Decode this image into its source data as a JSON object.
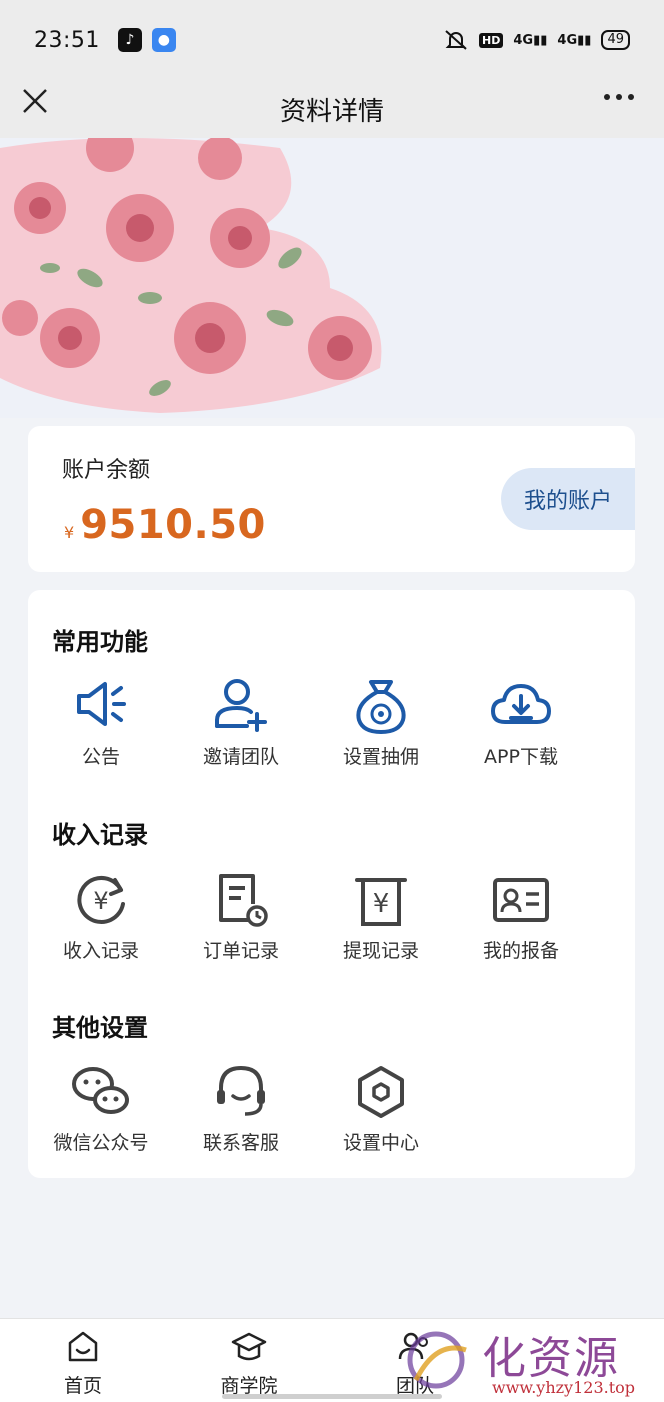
{
  "status_bar": {
    "time": "23:51",
    "hd_label": "HD",
    "signal1": "4G",
    "signal2": "4G",
    "battery": "49"
  },
  "nav": {
    "title": "资料详情"
  },
  "balance": {
    "label": "账户余额",
    "currency_symbol": "¥",
    "amount": "9510.50",
    "my_account_button": "我的账户"
  },
  "sections": {
    "common": {
      "title": "常用功能",
      "items": [
        {
          "label": "公告",
          "icon": "megaphone-icon"
        },
        {
          "label": "邀请团队",
          "icon": "add-user-icon"
        },
        {
          "label": "设置抽佣",
          "icon": "money-bag-icon"
        },
        {
          "label": "APP下载",
          "icon": "cloud-download-icon"
        }
      ]
    },
    "income": {
      "title": "收入记录",
      "items": [
        {
          "label": "收入记录",
          "icon": "yen-refresh-icon"
        },
        {
          "label": "订单记录",
          "icon": "order-clock-icon"
        },
        {
          "label": "提现记录",
          "icon": "withdraw-icon"
        },
        {
          "label": "我的报备",
          "icon": "id-card-icon"
        }
      ]
    },
    "other": {
      "title": "其他设置",
      "items": [
        {
          "label": "微信公众号",
          "icon": "wechat-icon"
        },
        {
          "label": "联系客服",
          "icon": "headset-icon"
        },
        {
          "label": "设置中心",
          "icon": "settings-hexagon-icon"
        }
      ]
    }
  },
  "tab_bar": {
    "tabs": [
      {
        "label": "首页",
        "icon": "home-icon"
      },
      {
        "label": "商学院",
        "icon": "graduation-cap-icon"
      },
      {
        "label": "团队",
        "icon": "team-icon"
      }
    ]
  },
  "watermark": {
    "text": "化资源网",
    "url": "www.yhzy123.top"
  },
  "colors": {
    "accent_blue": "#1d5aa8",
    "amount_orange": "#d8671f",
    "page_bg": "#f1f3f7"
  }
}
